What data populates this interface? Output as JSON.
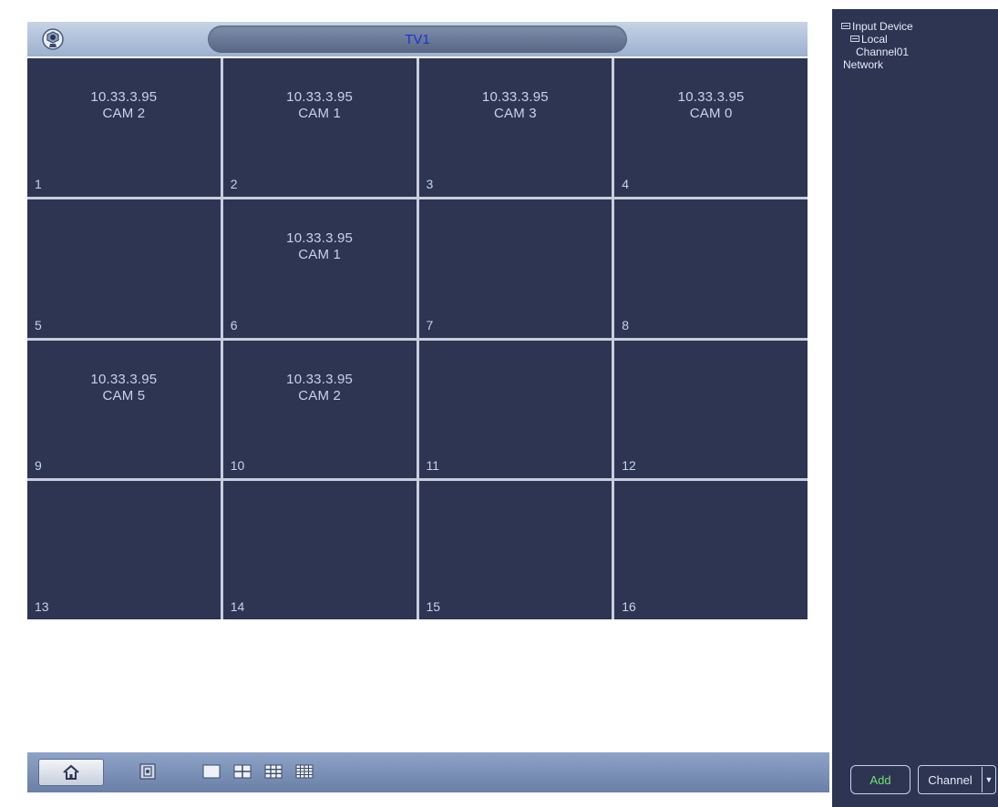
{
  "header": {
    "title": "TV1",
    "logo_icon": "camera-logo-icon"
  },
  "grid": {
    "cells": [
      {
        "num": "1",
        "ip": "10.33.3.95",
        "cam": "CAM 2"
      },
      {
        "num": "2",
        "ip": "10.33.3.95",
        "cam": "CAM 1"
      },
      {
        "num": "3",
        "ip": "10.33.3.95",
        "cam": "CAM 3"
      },
      {
        "num": "4",
        "ip": "10.33.3.95",
        "cam": "CAM 0"
      },
      {
        "num": "5",
        "ip": "",
        "cam": ""
      },
      {
        "num": "6",
        "ip": "10.33.3.95",
        "cam": "CAM 1"
      },
      {
        "num": "7",
        "ip": "",
        "cam": ""
      },
      {
        "num": "8",
        "ip": "",
        "cam": ""
      },
      {
        "num": "9",
        "ip": "10.33.3.95",
        "cam": "CAM 5"
      },
      {
        "num": "10",
        "ip": "10.33.3.95",
        "cam": "CAM 2"
      },
      {
        "num": "11",
        "ip": "",
        "cam": ""
      },
      {
        "num": "12",
        "ip": "",
        "cam": ""
      },
      {
        "num": "13",
        "ip": "",
        "cam": ""
      },
      {
        "num": "14",
        "ip": "",
        "cam": ""
      },
      {
        "num": "15",
        "ip": "",
        "cam": ""
      },
      {
        "num": "16",
        "ip": "",
        "cam": ""
      }
    ]
  },
  "toolbar": {
    "home_icon": "home-icon",
    "buttons": [
      "split-record-icon",
      "layout-1-icon",
      "layout-4-icon",
      "layout-9-icon",
      "layout-16-icon"
    ]
  },
  "sidebar": {
    "tree": {
      "root": "Input Device",
      "local": "Local",
      "channel": "Channel01",
      "network": "Network"
    },
    "add_label": "Add",
    "channel_select": "Channel"
  },
  "colors": {
    "cell_bg": "#2d3553",
    "panel_bg": "#2d3553",
    "cell_text": "#c6d2ea",
    "title_text": "#1e2fd8",
    "add_text": "#6ee36e"
  }
}
